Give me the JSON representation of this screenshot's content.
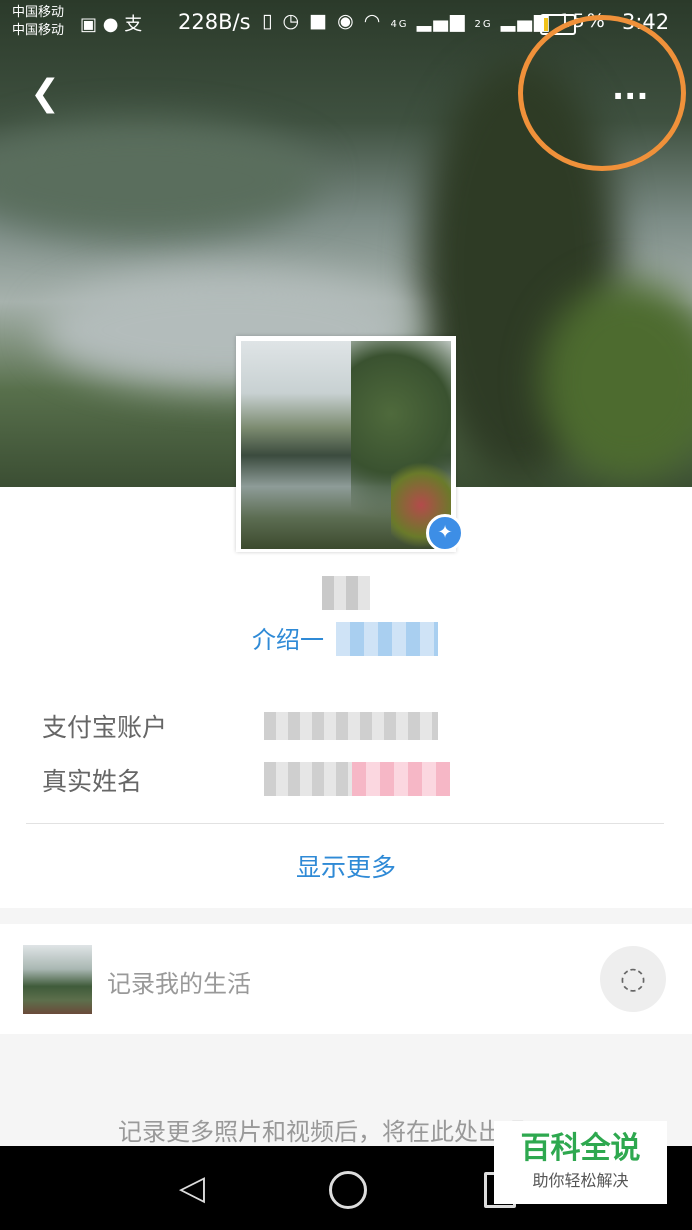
{
  "status_bar": {
    "carrier_1": "中国移动",
    "carrier_2": "中国移动",
    "network_speed": "228B/s",
    "signal_1": "4G",
    "signal_2": "2G",
    "battery_percent": "15%",
    "time": "3:42",
    "battery_level": 0.15,
    "battery_color": "#f0c21a"
  },
  "header": {
    "back_icon": "chevron-left-icon",
    "more_icon": "ellipsis-icon",
    "more_label": "..."
  },
  "profile": {
    "verified_icon": "verified-star-icon",
    "intro_text": "介绍一",
    "fields": [
      {
        "label": "支付宝账户"
      },
      {
        "label": "真实姓名"
      }
    ],
    "show_more": "显示更多"
  },
  "post_bar": {
    "placeholder": "记录我的生活",
    "camera_icon": "camera-icon"
  },
  "empty_message": "记录更多照片和视频后，将在此处出现",
  "nav_bar": {
    "back_icon": "triangle-back-icon",
    "home_icon": "circle-home-icon",
    "recent_icon": "square-recent-icon"
  },
  "watermark": {
    "title": "百科全说",
    "subtitle": "助你轻松解决"
  },
  "colors": {
    "accent_blue": "#2f8ad6",
    "highlight_orange": "#f0913a",
    "watermark_green": "#2ea84f"
  }
}
